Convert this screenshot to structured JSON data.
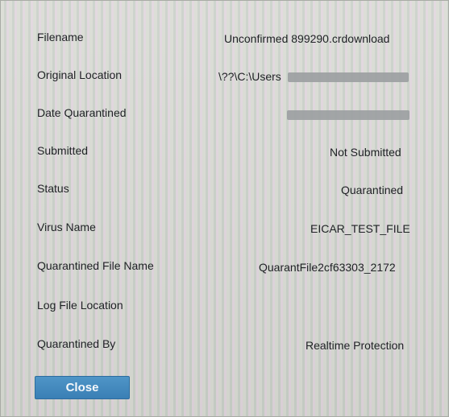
{
  "details": {
    "filename": {
      "label": "Filename",
      "value": "Unconfirmed 899290.crdownload"
    },
    "original_location": {
      "label": "Original Location",
      "value": "\\??\\C:\\Users"
    },
    "date_quarantined": {
      "label": "Date Quarantined",
      "value": ""
    },
    "submitted": {
      "label": "Submitted",
      "value": "Not Submitted"
    },
    "status": {
      "label": "Status",
      "value": "Quarantined"
    },
    "virus_name": {
      "label": "Virus Name",
      "value": "EICAR_TEST_FILE"
    },
    "quarantined_file_name": {
      "label": "Quarantined File Name",
      "value": "QuarantFile2cf63303_2172"
    },
    "log_file_location": {
      "label": "Log File Location",
      "value": ""
    },
    "quarantined_by": {
      "label": "Quarantined By",
      "value": "Realtime Protection"
    }
  },
  "buttons": {
    "close_label": "Close"
  }
}
